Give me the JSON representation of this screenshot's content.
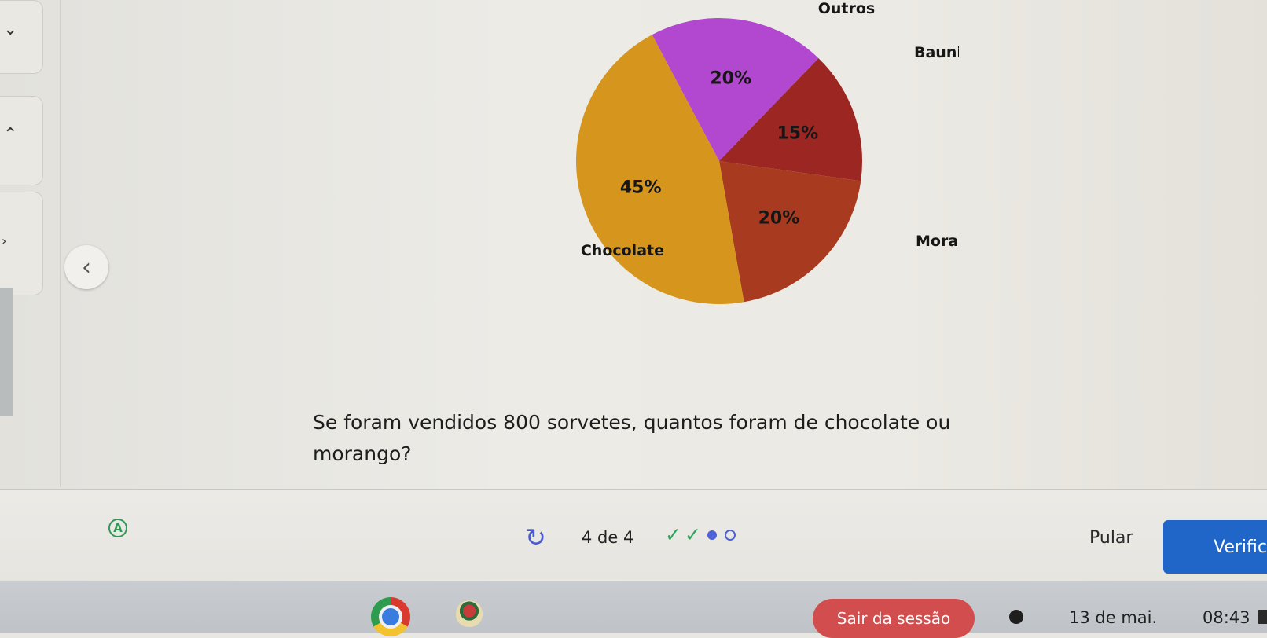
{
  "sidebar": {
    "caret_top_icon": "chevron-down-icon",
    "caret_mid_icon": "chevron-up-icon",
    "caret_low_icon": "chevron-right-icon"
  },
  "nav": {
    "prev_icon": "chevron-left-icon",
    "prev_glyph": "‹"
  },
  "chart_data": {
    "type": "pie",
    "labels": [
      "Outros",
      "Baunilha",
      "Morango",
      "Chocolate"
    ],
    "values": [
      20,
      15,
      20,
      45
    ],
    "value_labels": [
      "20%",
      "15%",
      "20%",
      "45%"
    ],
    "colors": [
      "#b148cf",
      "#9b2622",
      "#a83b1f",
      "#d6961d"
    ],
    "title": "",
    "legend": "none"
  },
  "question": {
    "text": "Se foram vendidos 800 sorvetes, quantos foram de chocolate ou morango?"
  },
  "footer": {
    "accessibility_glyph": "A",
    "retry_glyph": "↻",
    "progress": "4 de 4",
    "progress_current": 4,
    "progress_total": 4,
    "marks": [
      "✓",
      "✓"
    ],
    "skip_label": "Pular",
    "verify_label": "Verific"
  },
  "taskbar": {
    "logout_label": "Sair da sessão",
    "date": "13 de mai.",
    "time": "08:43"
  }
}
